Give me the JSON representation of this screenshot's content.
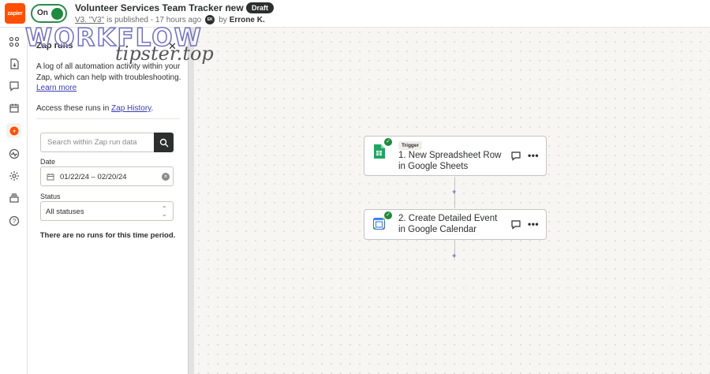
{
  "header": {
    "logo_text": "zapier",
    "toggle_label": "On",
    "zap_title": "Volunteer Services Team Tracker new",
    "draft_badge": "Draft",
    "version_link": "V3. \"V3\"",
    "published_text": "is published - 17 hours ago",
    "avatar_initials": "EK",
    "by_text": "by",
    "author": "Errone K."
  },
  "watermark": {
    "top": "WORKFLOW",
    "bottom": "tipster.top"
  },
  "sidebar": {
    "items": [
      {
        "icon": "apps-grid-icon"
      },
      {
        "icon": "file-download-icon"
      },
      {
        "icon": "chat-icon"
      },
      {
        "icon": "calendar-icon"
      },
      {
        "icon": "zap-runs-icon",
        "active": true
      },
      {
        "icon": "activity-icon"
      },
      {
        "icon": "settings-icon"
      },
      {
        "icon": "versions-icon"
      },
      {
        "icon": "help-icon"
      }
    ]
  },
  "panel": {
    "title": "Zap runs",
    "description": "A log of all automation activity within your Zap, which can help with troubleshooting.",
    "learn_more": "Learn more",
    "access_prefix": "Access these runs in",
    "zap_history_link": "Zap History",
    "access_suffix": ".",
    "search_placeholder": "Search within Zap run data",
    "date_label": "Date",
    "date_value": "01/22/24 – 02/20/24",
    "status_label": "Status",
    "status_value": "All statuses",
    "empty_message": "There are no runs for this time period."
  },
  "canvas": {
    "steps": [
      {
        "badge": "Trigger",
        "line1": "1. New Spreadsheet Row",
        "line2": "in Google Sheets",
        "app_icon": "google-sheets-icon"
      },
      {
        "badge": "",
        "line1": "2. Create Detailed Event",
        "line2": "in Google Calendar",
        "app_icon": "google-calendar-icon"
      }
    ]
  },
  "colors": {
    "brand_orange": "#ff4f00",
    "on_green": "#1f8a3f",
    "link_blue": "#3b3bb8",
    "canvas_bg": "#f7f6f3"
  }
}
